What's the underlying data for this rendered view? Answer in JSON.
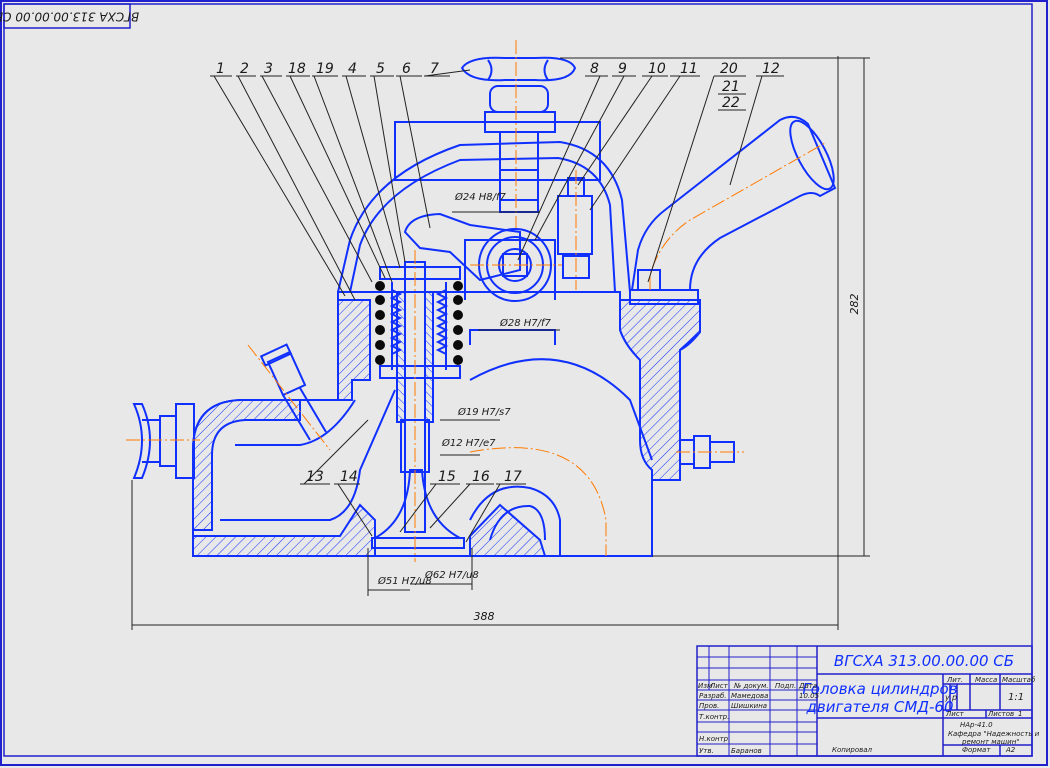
{
  "drawing": {
    "designation": "ВГСХА 313.00.00.00 СБ",
    "corner_designation": "ВГСХА 313.00.00.00 СБ",
    "title_line1": "Головка цилиндров",
    "title_line2": "двигателя СМД-60",
    "sheets_total": "1",
    "scale": "1:1",
    "sheet_label": "Лист",
    "sheets_label": "Листов",
    "sheets_value": "1",
    "group": "НАр-41.0",
    "department_line1": "Кафедра \"Надежность и",
    "department_line2": "ремонт машин\"",
    "copied_label": "Копировал",
    "format_label": "Формат",
    "format_value": "A2",
    "col_headers": [
      "Изм",
      "Лист",
      "№ докум.",
      "Подп.",
      "Дата"
    ],
    "role_labels": [
      "Разраб.",
      "Пров.",
      "Т.контр.",
      "Н.контр.",
      "Утв."
    ],
    "people": [
      "Мамедова",
      "Шишкина",
      "",
      "",
      "Баранов"
    ],
    "date": "10.05",
    "lit_label": "Лит.",
    "mass_label": "Масса",
    "scale_label": "Масштаб",
    "letter_u": "у",
    "letter_p": "р"
  },
  "callouts": [
    "1",
    "2",
    "3",
    "18",
    "19",
    "4",
    "5",
    "6",
    "7",
    "8",
    "9",
    "10",
    "11",
    "20",
    "21",
    "22",
    "12",
    "13",
    "14",
    "15",
    "16",
    "17"
  ],
  "dimensions": {
    "overall_width": "388",
    "overall_height": "282",
    "d24": "Ø24 H8/f7",
    "d28": "Ø28 H7/f7",
    "d19": "Ø19 H7/s7",
    "d12": "Ø12 H7/e7",
    "d51": "Ø51 H7/u8",
    "d62": "Ø62 H7/u8"
  },
  "colors": {
    "outline": "#1030ff",
    "axis": "#ff7a00",
    "frame": "#2020cc",
    "background": "#e8e8e8",
    "dimension": "#222222"
  }
}
